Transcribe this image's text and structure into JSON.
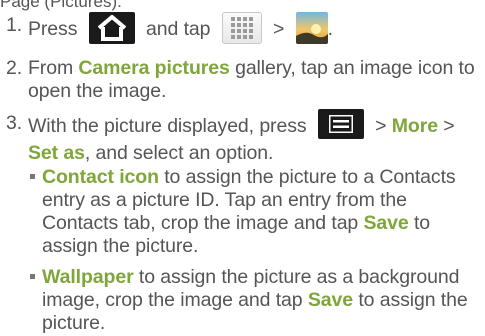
{
  "cut_line": "Page (Pictures).",
  "step1": {
    "num": "1.",
    "press": "Press",
    "and_tap": "and tap",
    "gt": ">",
    "end": ".",
    "icons": {
      "home": "home-key-icon",
      "apps": "applications-grid-icon",
      "gallery": "gallery-app-icon"
    }
  },
  "step2": {
    "num": "2.",
    "pre": "From ",
    "bold": "Camera pictures",
    "post": " gallery, tap an image icon to open the image."
  },
  "step3": {
    "num": "3.",
    "pre": "With the picture displayed, press",
    "gt1": " > ",
    "more": "More",
    "gt2": " > ",
    "set_as": "Set as",
    "post": ", and select an option.",
    "icons": {
      "menu": "menu-key-icon"
    }
  },
  "bullet1": {
    "bold": "Contact icon",
    "mid": " to assign the picture to a Contacts entry as a picture ID. Tap an entry from the Contacts tab, crop the image and tap ",
    "save": "Save",
    "post": " to assign the picture."
  },
  "bullet2": {
    "bold": "Wallpaper",
    "mid": " to assign the picture as a background image, crop the image and tap ",
    "save": "Save",
    "post": " to assign the picture."
  },
  "colors": {
    "accent": "#7fa63a",
    "text": "#555555",
    "key_bg": "#1a1a1a"
  }
}
